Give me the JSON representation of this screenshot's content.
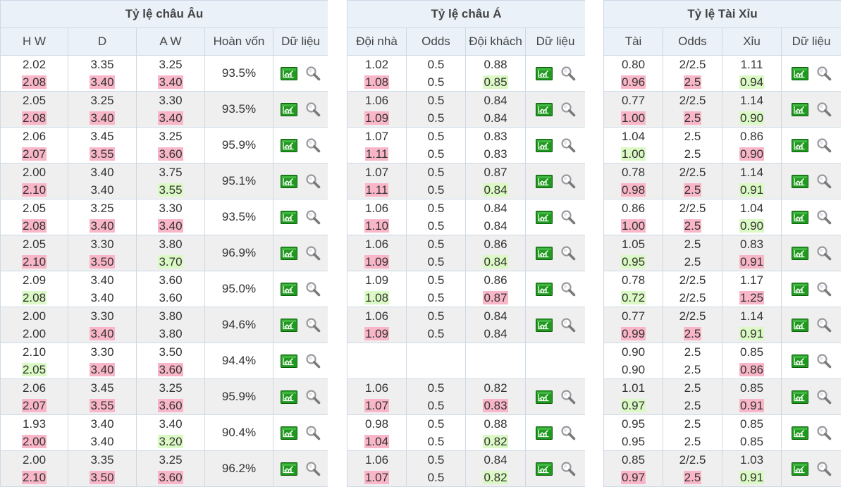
{
  "colors": {
    "header_bg": "#eaf1f9",
    "border": "#cdd9e6",
    "row_alt_bg": "#efefef",
    "highlight_up": "#f9b6c8",
    "highlight_down": "#dbf9c4",
    "chart_icon_green": "#1f9a1f"
  },
  "icons": {
    "chart": "line-chart-icon",
    "search": "magnifier-icon"
  },
  "european": {
    "title": "Tỷ lệ châu Âu",
    "columns": [
      "H W",
      "D",
      "A W",
      "Hoàn vốn",
      "Dữ liệu"
    ],
    "rows": [
      {
        "hw": [
          "2.02",
          "2.08"
        ],
        "hw_hl": [
          "",
          "up"
        ],
        "d": [
          "3.35",
          "3.40"
        ],
        "d_hl": [
          "",
          "up"
        ],
        "aw": [
          "3.25",
          "3.40"
        ],
        "aw_hl": [
          "",
          "up"
        ],
        "payout": "93.5%"
      },
      {
        "hw": [
          "2.05",
          "2.08"
        ],
        "hw_hl": [
          "",
          "up"
        ],
        "d": [
          "3.25",
          "3.40"
        ],
        "d_hl": [
          "",
          "up"
        ],
        "aw": [
          "3.30",
          "3.40"
        ],
        "aw_hl": [
          "",
          "up"
        ],
        "payout": "93.5%"
      },
      {
        "hw": [
          "2.06",
          "2.07"
        ],
        "hw_hl": [
          "",
          "up"
        ],
        "d": [
          "3.45",
          "3.55"
        ],
        "d_hl": [
          "",
          "up"
        ],
        "aw": [
          "3.25",
          "3.60"
        ],
        "aw_hl": [
          "",
          "up"
        ],
        "payout": "95.9%"
      },
      {
        "hw": [
          "2.00",
          "2.10"
        ],
        "hw_hl": [
          "",
          "up"
        ],
        "d": [
          "3.40",
          "3.40"
        ],
        "d_hl": [
          "",
          ""
        ],
        "aw": [
          "3.75",
          "3.55"
        ],
        "aw_hl": [
          "",
          "down"
        ],
        "payout": "95.1%"
      },
      {
        "hw": [
          "2.05",
          "2.08"
        ],
        "hw_hl": [
          "",
          "up"
        ],
        "d": [
          "3.25",
          "3.40"
        ],
        "d_hl": [
          "",
          "up"
        ],
        "aw": [
          "3.30",
          "3.40"
        ],
        "aw_hl": [
          "",
          "up"
        ],
        "payout": "93.5%"
      },
      {
        "hw": [
          "2.05",
          "2.10"
        ],
        "hw_hl": [
          "",
          "up"
        ],
        "d": [
          "3.30",
          "3.50"
        ],
        "d_hl": [
          "",
          "up"
        ],
        "aw": [
          "3.80",
          "3.70"
        ],
        "aw_hl": [
          "",
          "down"
        ],
        "payout": "96.9%"
      },
      {
        "hw": [
          "2.09",
          "2.08"
        ],
        "hw_hl": [
          "",
          "down"
        ],
        "d": [
          "3.40",
          "3.40"
        ],
        "d_hl": [
          "",
          ""
        ],
        "aw": [
          "3.60",
          "3.60"
        ],
        "aw_hl": [
          "",
          ""
        ],
        "payout": "95.0%"
      },
      {
        "hw": [
          "2.00",
          "2.00"
        ],
        "hw_hl": [
          "",
          ""
        ],
        "d": [
          "3.30",
          "3.40"
        ],
        "d_hl": [
          "",
          "up"
        ],
        "aw": [
          "3.80",
          "3.80"
        ],
        "aw_hl": [
          "",
          ""
        ],
        "payout": "94.6%"
      },
      {
        "hw": [
          "2.10",
          "2.05"
        ],
        "hw_hl": [
          "",
          "down"
        ],
        "d": [
          "3.30",
          "3.40"
        ],
        "d_hl": [
          "",
          "up"
        ],
        "aw": [
          "3.50",
          "3.60"
        ],
        "aw_hl": [
          "",
          "up"
        ],
        "payout": "94.4%"
      },
      {
        "hw": [
          "2.06",
          "2.07"
        ],
        "hw_hl": [
          "",
          "up"
        ],
        "d": [
          "3.45",
          "3.55"
        ],
        "d_hl": [
          "",
          "up"
        ],
        "aw": [
          "3.25",
          "3.60"
        ],
        "aw_hl": [
          "",
          "up"
        ],
        "payout": "95.9%"
      },
      {
        "hw": [
          "1.93",
          "2.00"
        ],
        "hw_hl": [
          "",
          "up"
        ],
        "d": [
          "3.40",
          "3.40"
        ],
        "d_hl": [
          "",
          ""
        ],
        "aw": [
          "3.40",
          "3.20"
        ],
        "aw_hl": [
          "",
          "down"
        ],
        "payout": "90.4%"
      },
      {
        "hw": [
          "2.00",
          "2.10"
        ],
        "hw_hl": [
          "",
          "up"
        ],
        "d": [
          "3.35",
          "3.50"
        ],
        "d_hl": [
          "",
          "up"
        ],
        "aw": [
          "3.25",
          "3.60"
        ],
        "aw_hl": [
          "",
          "up"
        ],
        "payout": "96.2%"
      }
    ]
  },
  "asian": {
    "title": "Tỷ lệ châu Á",
    "columns": [
      "Đội nhà",
      "Odds",
      "Đội khách",
      "Dữ liệu"
    ],
    "rows": [
      {
        "empty": false,
        "home": [
          "1.02",
          "1.08"
        ],
        "home_hl": [
          "",
          "up"
        ],
        "odds": [
          "0.5",
          "0.5"
        ],
        "odds_hl": [
          "",
          ""
        ],
        "away": [
          "0.88",
          "0.85"
        ],
        "away_hl": [
          "",
          "down"
        ]
      },
      {
        "empty": false,
        "home": [
          "1.06",
          "1.09"
        ],
        "home_hl": [
          "",
          "up"
        ],
        "odds": [
          "0.5",
          "0.5"
        ],
        "odds_hl": [
          "",
          ""
        ],
        "away": [
          "0.84",
          "0.84"
        ],
        "away_hl": [
          "",
          ""
        ]
      },
      {
        "empty": false,
        "home": [
          "1.07",
          "1.11"
        ],
        "home_hl": [
          "",
          "up"
        ],
        "odds": [
          "0.5",
          "0.5"
        ],
        "odds_hl": [
          "",
          ""
        ],
        "away": [
          "0.83",
          "0.83"
        ],
        "away_hl": [
          "",
          ""
        ]
      },
      {
        "empty": false,
        "home": [
          "1.07",
          "1.11"
        ],
        "home_hl": [
          "",
          "up"
        ],
        "odds": [
          "0.5",
          "0.5"
        ],
        "odds_hl": [
          "",
          ""
        ],
        "away": [
          "0.87",
          "0.84"
        ],
        "away_hl": [
          "",
          "down"
        ]
      },
      {
        "empty": false,
        "home": [
          "1.06",
          "1.10"
        ],
        "home_hl": [
          "",
          "up"
        ],
        "odds": [
          "0.5",
          "0.5"
        ],
        "odds_hl": [
          "",
          ""
        ],
        "away": [
          "0.84",
          "0.84"
        ],
        "away_hl": [
          "",
          ""
        ]
      },
      {
        "empty": false,
        "home": [
          "1.06",
          "1.09"
        ],
        "home_hl": [
          "",
          "up"
        ],
        "odds": [
          "0.5",
          "0.5"
        ],
        "odds_hl": [
          "",
          ""
        ],
        "away": [
          "0.86",
          "0.84"
        ],
        "away_hl": [
          "",
          "down"
        ]
      },
      {
        "empty": false,
        "home": [
          "1.09",
          "1.08"
        ],
        "home_hl": [
          "",
          "down"
        ],
        "odds": [
          "0.5",
          "0.5"
        ],
        "odds_hl": [
          "",
          ""
        ],
        "away": [
          "0.86",
          "0.87"
        ],
        "away_hl": [
          "",
          "up"
        ]
      },
      {
        "empty": false,
        "home": [
          "1.06",
          "1.09"
        ],
        "home_hl": [
          "",
          "up"
        ],
        "odds": [
          "0.5",
          "0.5"
        ],
        "odds_hl": [
          "",
          ""
        ],
        "away": [
          "0.84",
          "0.84"
        ],
        "away_hl": [
          "",
          ""
        ]
      },
      {
        "empty": true
      },
      {
        "empty": false,
        "home": [
          "1.06",
          "1.07"
        ],
        "home_hl": [
          "",
          "up"
        ],
        "odds": [
          "0.5",
          "0.5"
        ],
        "odds_hl": [
          "",
          ""
        ],
        "away": [
          "0.82",
          "0.83"
        ],
        "away_hl": [
          "",
          "up"
        ]
      },
      {
        "empty": false,
        "home": [
          "0.98",
          "1.04"
        ],
        "home_hl": [
          "",
          "up"
        ],
        "odds": [
          "0.5",
          "0.5"
        ],
        "odds_hl": [
          "",
          ""
        ],
        "away": [
          "0.88",
          "0.82"
        ],
        "away_hl": [
          "",
          "down"
        ]
      },
      {
        "empty": false,
        "home": [
          "1.06",
          "1.07"
        ],
        "home_hl": [
          "",
          "up"
        ],
        "odds": [
          "0.5",
          "0.5"
        ],
        "odds_hl": [
          "",
          ""
        ],
        "away": [
          "0.84",
          "0.82"
        ],
        "away_hl": [
          "",
          "down"
        ]
      }
    ]
  },
  "overunder": {
    "title": "Tỷ lệ Tài Xỉu",
    "columns": [
      "Tài",
      "Odds",
      "Xỉu",
      "Dữ liệu"
    ],
    "rows": [
      {
        "over": [
          "0.80",
          "0.96"
        ],
        "over_hl": [
          "",
          "up"
        ],
        "odds": [
          "2/2.5",
          "2.5"
        ],
        "odds_hl": [
          "",
          "up"
        ],
        "under": [
          "1.11",
          "0.94"
        ],
        "under_hl": [
          "",
          "down"
        ]
      },
      {
        "over": [
          "0.77",
          "1.00"
        ],
        "over_hl": [
          "",
          "up"
        ],
        "odds": [
          "2/2.5",
          "2.5"
        ],
        "odds_hl": [
          "",
          "up"
        ],
        "under": [
          "1.14",
          "0.90"
        ],
        "under_hl": [
          "",
          "down"
        ]
      },
      {
        "over": [
          "1.04",
          "1.00"
        ],
        "over_hl": [
          "",
          "down"
        ],
        "odds": [
          "2.5",
          "2.5"
        ],
        "odds_hl": [
          "",
          ""
        ],
        "under": [
          "0.86",
          "0.90"
        ],
        "under_hl": [
          "",
          "up"
        ]
      },
      {
        "over": [
          "0.78",
          "0.98"
        ],
        "over_hl": [
          "",
          "up"
        ],
        "odds": [
          "2/2.5",
          "2.5"
        ],
        "odds_hl": [
          "",
          "up"
        ],
        "under": [
          "1.14",
          "0.91"
        ],
        "under_hl": [
          "",
          "down"
        ]
      },
      {
        "over": [
          "0.86",
          "1.00"
        ],
        "over_hl": [
          "",
          "up"
        ],
        "odds": [
          "2/2.5",
          "2.5"
        ],
        "odds_hl": [
          "",
          "up"
        ],
        "under": [
          "1.04",
          "0.90"
        ],
        "under_hl": [
          "",
          "down"
        ]
      },
      {
        "over": [
          "1.05",
          "0.95"
        ],
        "over_hl": [
          "",
          "down"
        ],
        "odds": [
          "2.5",
          "2.5"
        ],
        "odds_hl": [
          "",
          ""
        ],
        "under": [
          "0.83",
          "0.91"
        ],
        "under_hl": [
          "",
          "up"
        ]
      },
      {
        "over": [
          "0.78",
          "0.72"
        ],
        "over_hl": [
          "",
          "down"
        ],
        "odds": [
          "2/2.5",
          "2/2.5"
        ],
        "odds_hl": [
          "",
          ""
        ],
        "under": [
          "1.17",
          "1.25"
        ],
        "under_hl": [
          "",
          "up"
        ]
      },
      {
        "over": [
          "0.77",
          "0.99"
        ],
        "over_hl": [
          "",
          "up"
        ],
        "odds": [
          "2/2.5",
          "2.5"
        ],
        "odds_hl": [
          "",
          "up"
        ],
        "under": [
          "1.14",
          "0.91"
        ],
        "under_hl": [
          "",
          "down"
        ]
      },
      {
        "over": [
          "0.90",
          "0.90"
        ],
        "over_hl": [
          "",
          ""
        ],
        "odds": [
          "2.5",
          "2.5"
        ],
        "odds_hl": [
          "",
          ""
        ],
        "under": [
          "0.85",
          "0.86"
        ],
        "under_hl": [
          "",
          "up"
        ]
      },
      {
        "over": [
          "1.01",
          "0.97"
        ],
        "over_hl": [
          "",
          "down"
        ],
        "odds": [
          "2.5",
          "2.5"
        ],
        "odds_hl": [
          "",
          ""
        ],
        "under": [
          "0.85",
          "0.91"
        ],
        "under_hl": [
          "",
          "up"
        ]
      },
      {
        "over": [
          "0.95",
          "0.95"
        ],
        "over_hl": [
          "",
          ""
        ],
        "odds": [
          "2.5",
          "2.5"
        ],
        "odds_hl": [
          "",
          ""
        ],
        "under": [
          "0.85",
          "0.85"
        ],
        "under_hl": [
          "",
          ""
        ]
      },
      {
        "over": [
          "0.85",
          "0.97"
        ],
        "over_hl": [
          "",
          "up"
        ],
        "odds": [
          "2/2.5",
          "2.5"
        ],
        "odds_hl": [
          "",
          "up"
        ],
        "under": [
          "1.03",
          "0.91"
        ],
        "under_hl": [
          "",
          "down"
        ]
      }
    ]
  }
}
